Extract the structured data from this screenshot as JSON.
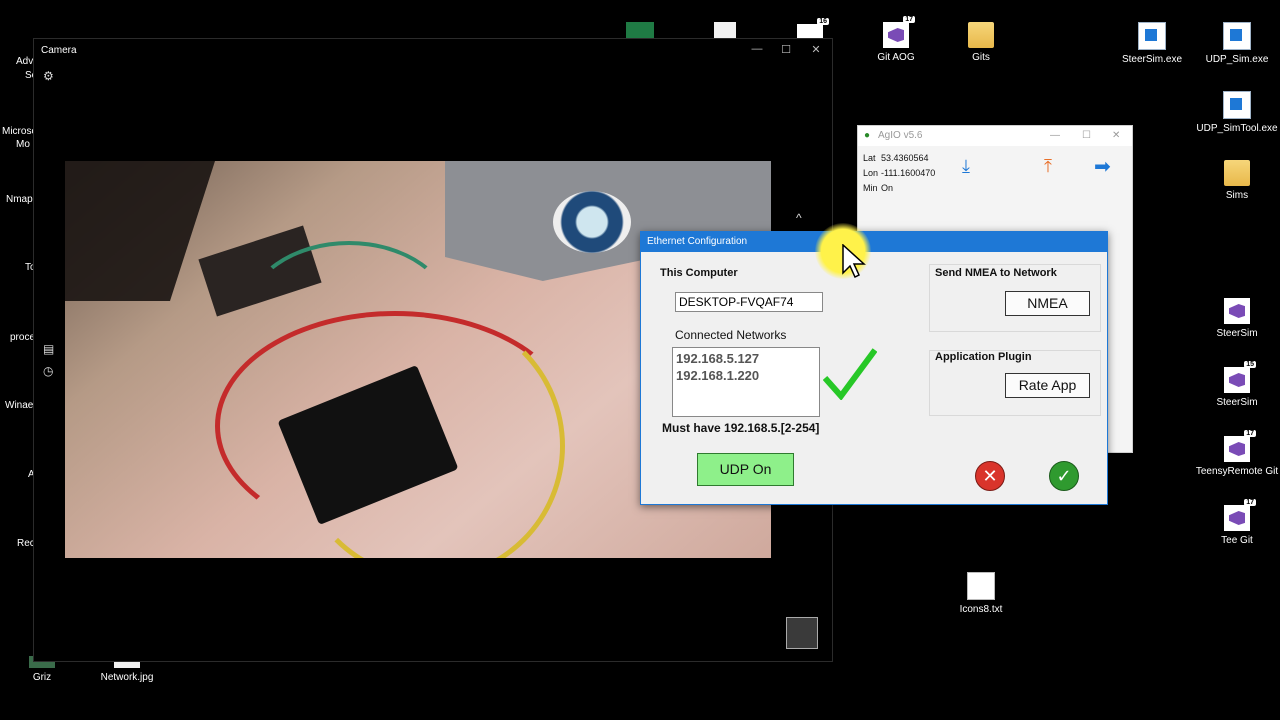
{
  "desktop_icons": {
    "git_aog": {
      "label": "Git AOG",
      "badge": "17"
    },
    "gits": {
      "label": "Gits"
    },
    "steersim_exe": {
      "label": "SteerSim.exe"
    },
    "udp_sim_exe": {
      "label": "UDP_Sim.exe"
    },
    "udp_simtool_exe": {
      "label": "UDP_SimTool.exe"
    },
    "sims": {
      "label": "Sims"
    },
    "steersim_vs": {
      "label": "SteerSim"
    },
    "steersim_vs15": {
      "label": "SteerSim",
      "badge": "15"
    },
    "teensyremote_git": {
      "label": "TeensyRemote Git",
      "badge": "17"
    },
    "tee_git": {
      "label": "Tee Git",
      "badge": "17"
    },
    "icons8": {
      "label": "Icons8.txt"
    },
    "griz": {
      "label": "Griz"
    },
    "network_jpg": {
      "label": "Network.jpg"
    },
    "top_badge": "16"
  },
  "partial_left_labels": [
    "Adv",
    "Sc",
    "Microso",
    "Mo",
    "Nmap",
    "To",
    "proce",
    "Winae",
    "A",
    "Rec"
  ],
  "camera_window": {
    "title": "Camera",
    "minimize": "—",
    "maximize": "☐",
    "close": "✕",
    "collapse_caret": "^"
  },
  "agio_window": {
    "title": "AgIO v5.6",
    "lat_label": "Lat",
    "lat_value": "53.4360564",
    "lon_label": "Lon",
    "lon_value": "-111.1600470",
    "min_label": "Min",
    "min_value": "On"
  },
  "ethernet_dialog": {
    "title": "Ethernet Configuration",
    "this_computer_label": "This Computer",
    "computer_name": "DESKTOP-FVQAF74",
    "connected_networks_label": "Connected Networks",
    "networks": [
      "192.168.5.127",
      "192.168.1.220"
    ],
    "must_have_text": "Must have 192.168.5.[2-254]",
    "udp_button": "UDP On",
    "send_nmea_label": "Send NMEA to Network",
    "nmea_button": "NMEA",
    "app_plugin_label": "Application Plugin",
    "rate_app_button": "Rate App",
    "colors": {
      "titlebar": "#1e78d6",
      "udp_on": "#8ef08a",
      "cancel": "#d9342b",
      "ok": "#2f9a2f"
    }
  }
}
